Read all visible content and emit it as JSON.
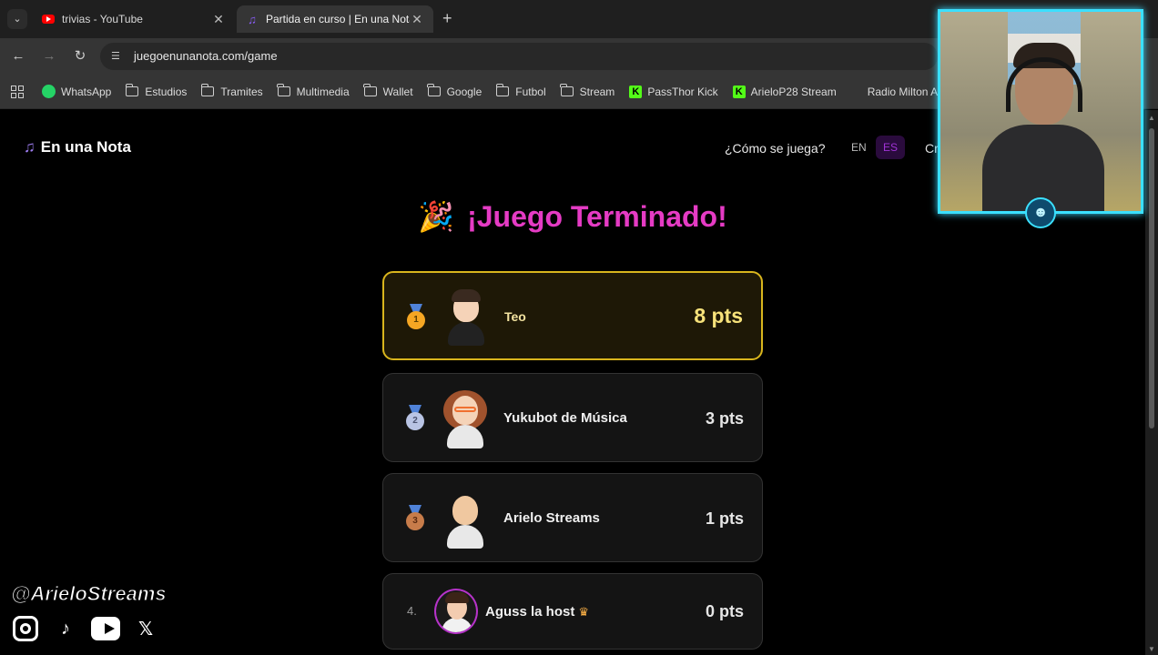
{
  "browser": {
    "tabs": [
      {
        "label": "trivias - YouTube",
        "active": false
      },
      {
        "label": "Partida en curso | En una Nota",
        "active": true
      }
    ],
    "url": "juegoenunanota.com/game",
    "bookmarks": [
      {
        "label": "WhatsApp",
        "icon": "whatsapp-icon"
      },
      {
        "label": "Estudios",
        "icon": "folder-icon"
      },
      {
        "label": "Tramites",
        "icon": "folder-icon"
      },
      {
        "label": "Multimedia",
        "icon": "folder-icon"
      },
      {
        "label": "Wallet",
        "icon": "folder-icon"
      },
      {
        "label": "Google",
        "icon": "folder-icon"
      },
      {
        "label": "Futbol",
        "icon": "folder-icon"
      },
      {
        "label": "Stream",
        "icon": "folder-icon"
      },
      {
        "label": "PassThor Kick",
        "icon": "kick-icon"
      },
      {
        "label": "ArieloP28 Stream",
        "icon": "kick-icon"
      },
      {
        "label": "Radio Milton Aguil",
        "icon": "radio-icon"
      }
    ]
  },
  "site": {
    "brand": "En una Nota",
    "how_to_play": "¿Cómo se juega?",
    "lang_en": "EN",
    "lang_es": "ES",
    "cut_label": "Cr",
    "heading": "¡Juego Terminado!"
  },
  "leaderboard": [
    {
      "rank": "1",
      "name": "Teo",
      "points": "8 pts"
    },
    {
      "rank": "2",
      "name": "Yukubot de Música",
      "points": "3 pts"
    },
    {
      "rank": "3",
      "name": "Arielo Streams",
      "points": "1 pts"
    },
    {
      "rank": "4.",
      "name": "Aguss la host",
      "points": "0 pts"
    }
  ],
  "overlay": {
    "handle": "@ArieloStreams"
  },
  "colors": {
    "accent_pink": "#e53bc4",
    "gold_border": "#d9b51d",
    "webcam_border": "#3be0ff"
  }
}
